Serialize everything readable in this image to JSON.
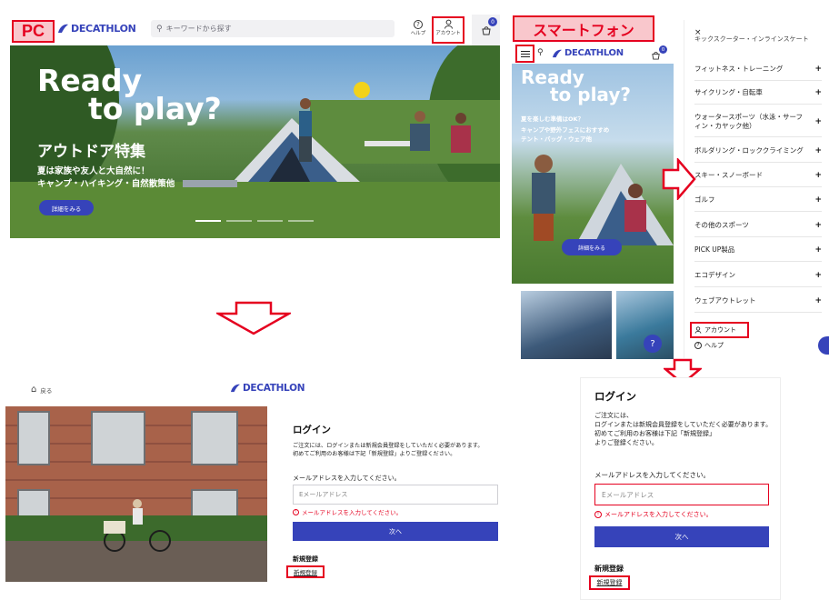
{
  "labels": {
    "pc": "PC",
    "smartphone": "スマートフォン"
  },
  "pc": {
    "logo": "DECATHLON",
    "search_placeholder": "キーワードから探す",
    "help_label": "ヘルプ",
    "account_label": "アカウント",
    "cart_count": "0",
    "hero": {
      "title_line1": "Ready",
      "title_line2": "to play?",
      "headline": "アウトドア特集",
      "sub_line1": "夏は家族や友人と大自然に！",
      "sub_line2": "キャンプ・ハイキング・自然散策他",
      "cta": "詳細をみる"
    }
  },
  "sp": {
    "logo": "DECATHLON",
    "cart_count": "0",
    "hero": {
      "title_line1": "Ready",
      "title_line2": "to play?",
      "sub_line1": "夏を楽しむ準備はOK？",
      "sub_line2": "キャンプや野外フェスにおすすめ",
      "sub_line3": "テント・バッグ・ウェア他",
      "cta": "詳細をみる"
    },
    "menu": {
      "close": "×",
      "top_truncated": "キックスクーター・インラインスケート",
      "items": [
        "フィットネス・トレーニング",
        "サイクリング・自転車",
        "ウォータースポーツ（水泳・サーフィン・カヤック他）",
        "ボルダリング・ロッククライミング",
        "スキー・スノーボード",
        "ゴルフ",
        "その他のスポーツ",
        "PICK UP製品",
        "エコデザイン",
        "ウェブアウトレット"
      ],
      "account": "アカウント",
      "help": "ヘルプ"
    }
  },
  "login_pc": {
    "back": "戻る",
    "logo": "DECATHLON",
    "title": "ログイン",
    "desc_line1": "ご注文には、ログインまたは新規会員登録をしていただく必要があります。",
    "desc_line2": "初めてご利用のお客様は下記「新規登録」よりご登録ください。",
    "email_label": "メールアドレスを入力してください。",
    "email_placeholder": "Eメールアドレス",
    "error": "メールアドレスを入力してください。",
    "next": "次へ",
    "register_title": "新規登録",
    "register_link": "新規登録"
  },
  "login_sp": {
    "title": "ログイン",
    "desc_line1": "ご注文には、",
    "desc_line2": "ログインまたは新規会員登録をしていただく必要があります。",
    "desc_line3": "初めてご利用のお客様は下記「新規登録」",
    "desc_line4": "よりご登録ください。",
    "email_label": "メールアドレスを入力してください。",
    "email_placeholder": "Eメールアドレス",
    "error": "メールアドレスを入力してください。",
    "next": "次へ",
    "register_title": "新規登録",
    "register_link": "新規登録"
  },
  "colors": {
    "brand": "#3643ba",
    "highlight": "#e5001f",
    "label_bg": "#f9c7cc"
  }
}
